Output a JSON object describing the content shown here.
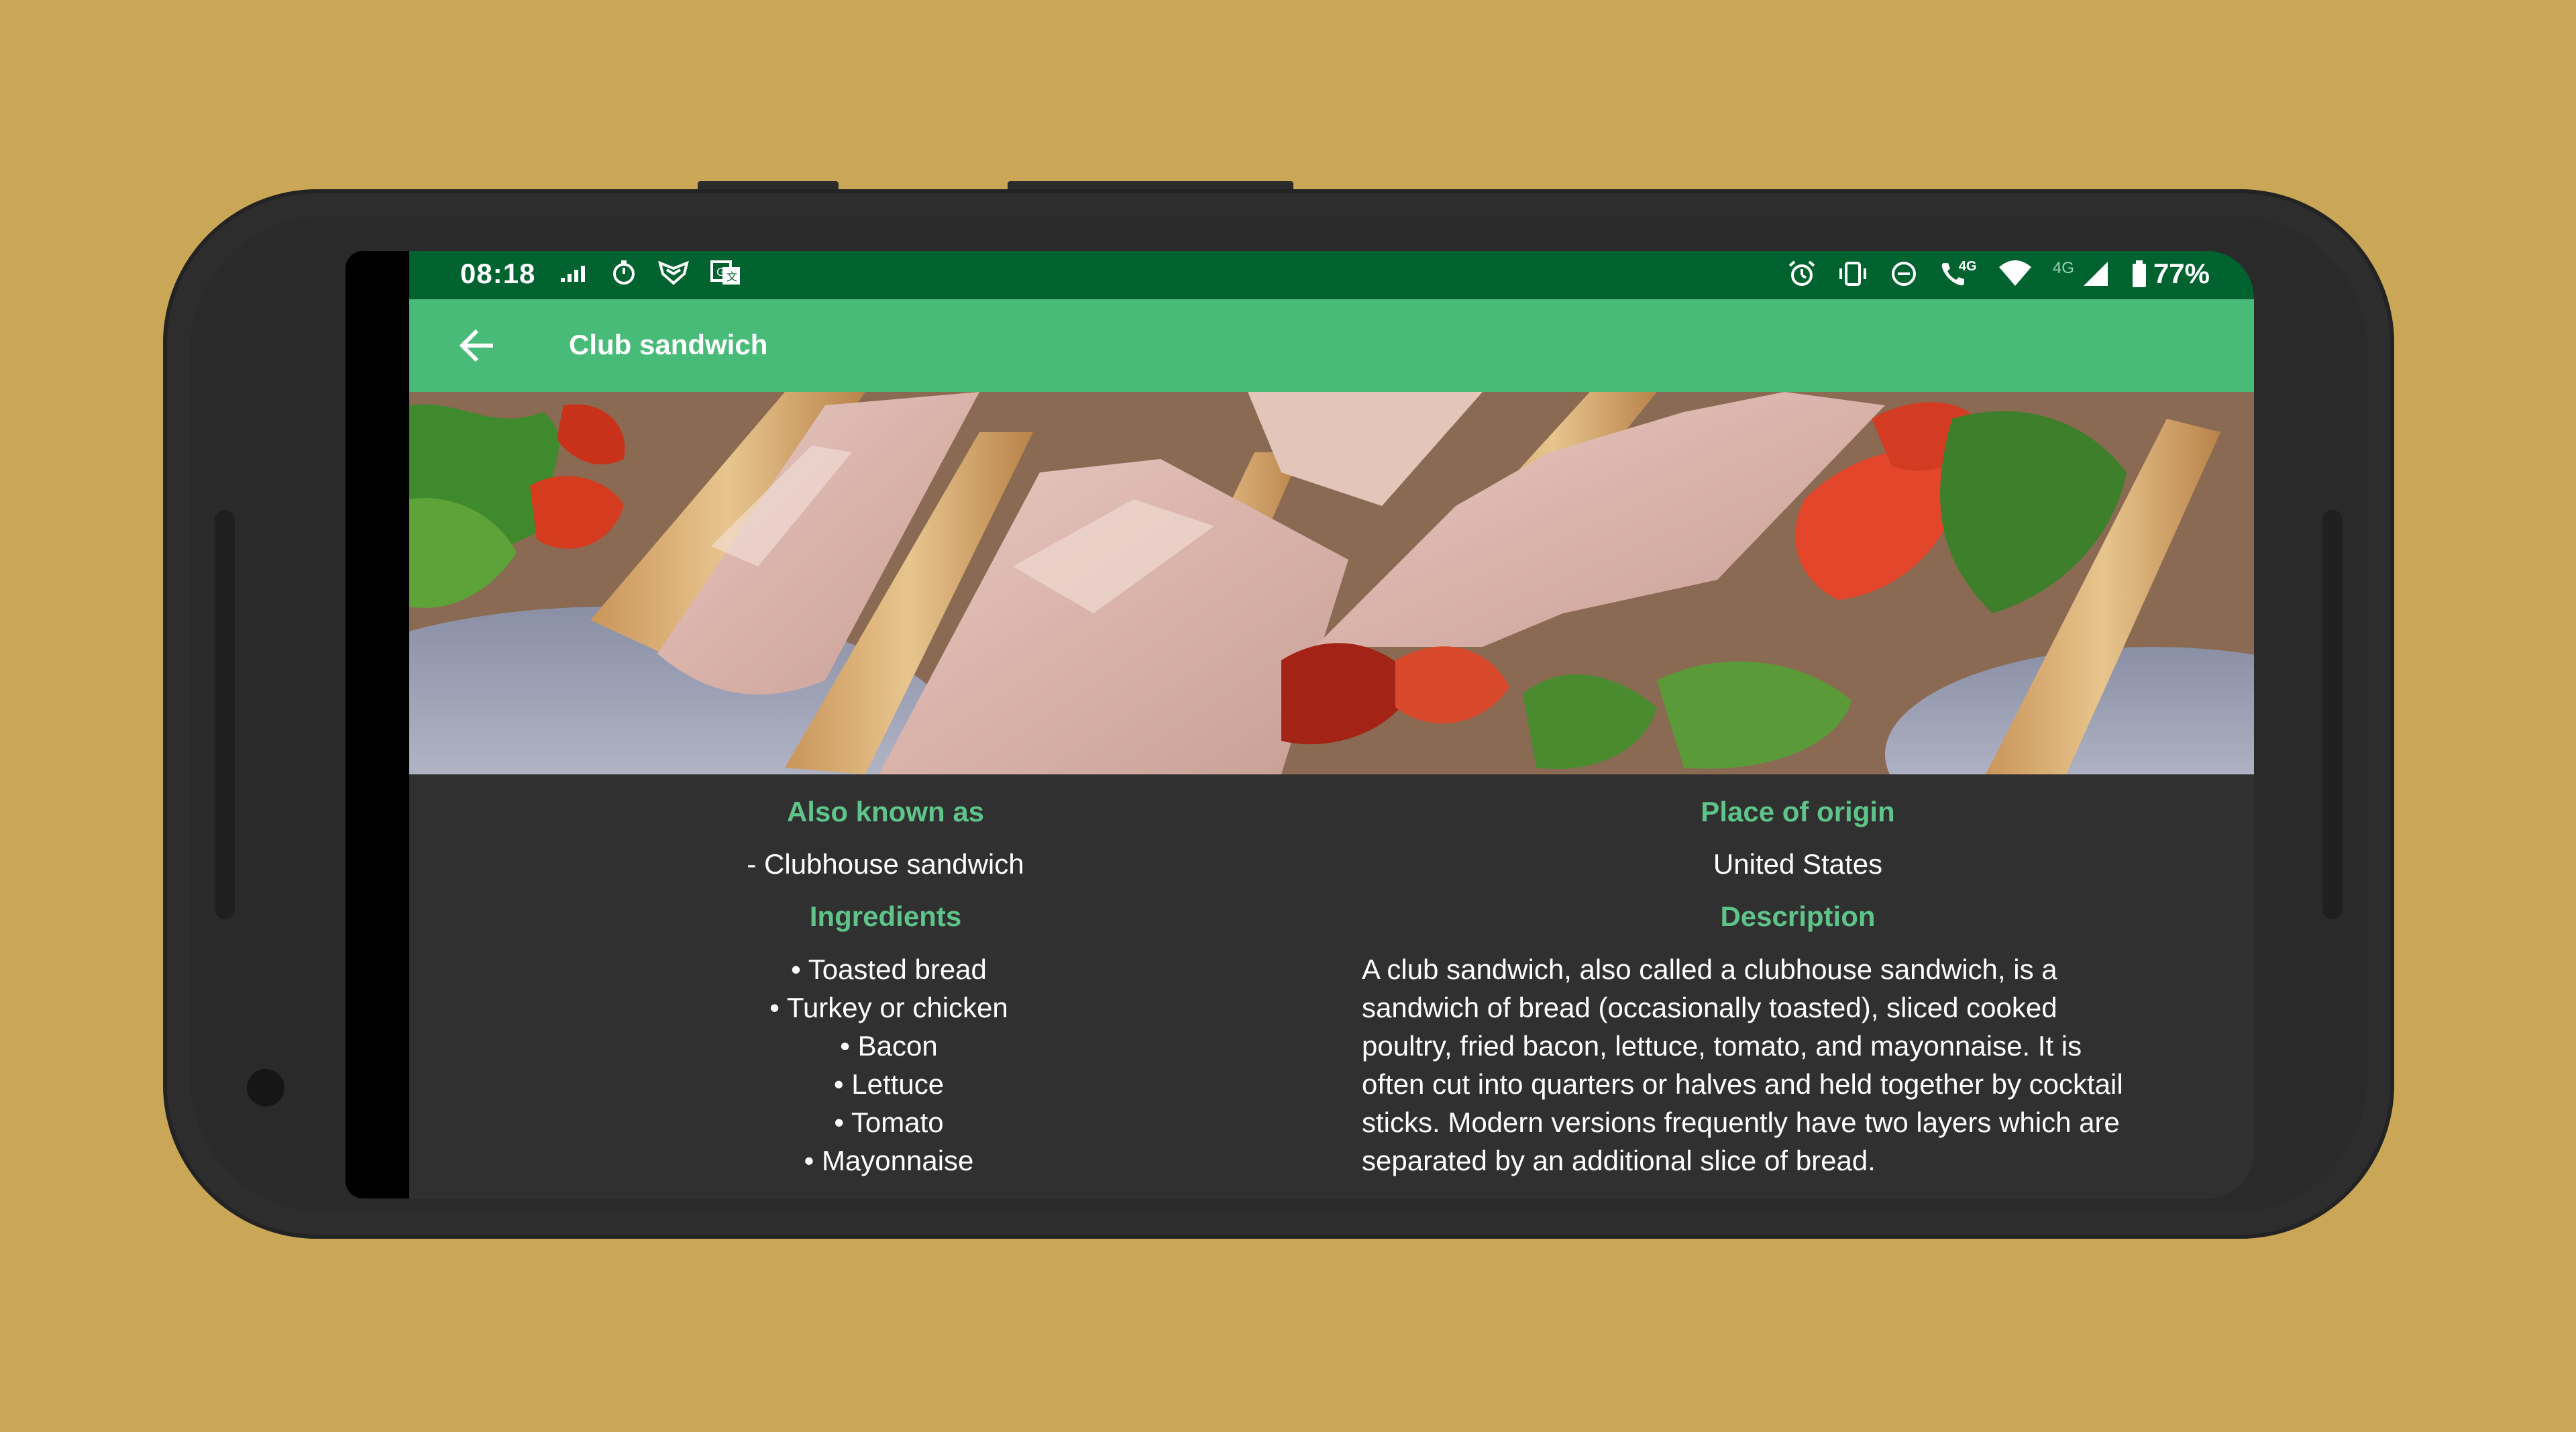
{
  "status_bar": {
    "time": "08:18",
    "left_icons": [
      "signal-bars-icon",
      "stopwatch-icon",
      "shield-badge-icon",
      "translate-icon"
    ],
    "right_icons": [
      "alarm-icon",
      "vibrate-icon",
      "do-not-disturb-icon",
      "wifi-calling-icon",
      "wifi-icon",
      "mobile-signal-icon",
      "battery-icon"
    ],
    "call_badge": "4G",
    "network_label": "4G",
    "battery": "77%"
  },
  "toolbar": {
    "title": "Club sandwich",
    "back_icon": "back-arrow-icon",
    "color": "#49bb79"
  },
  "status_color": "#00632f",
  "accent_color": "#5ec48a",
  "left_column": {
    "also_known_as_heading": "Also known as",
    "also_known_as_value": "- Clubhouse sandwich",
    "ingredients_heading": "Ingredients",
    "ingredients": [
      "• Toasted bread",
      "• Turkey or chicken",
      "• Bacon",
      "• Lettuce",
      "• Tomato",
      "• Mayonnaise"
    ]
  },
  "right_column": {
    "origin_heading": "Place of origin",
    "origin_value": "United States",
    "description_heading": "Description",
    "description_lines": [
      "A club sandwich, also called a clubhouse sandwich, is a",
      "sandwich of bread (occasionally toasted), sliced cooked",
      "poultry, fried bacon, lettuce, tomato, and mayonnaise. It is",
      "often cut into quarters or halves and held together by cocktail",
      "sticks. Modern versions frequently have two layers which are",
      "separated by an additional slice of bread."
    ]
  }
}
